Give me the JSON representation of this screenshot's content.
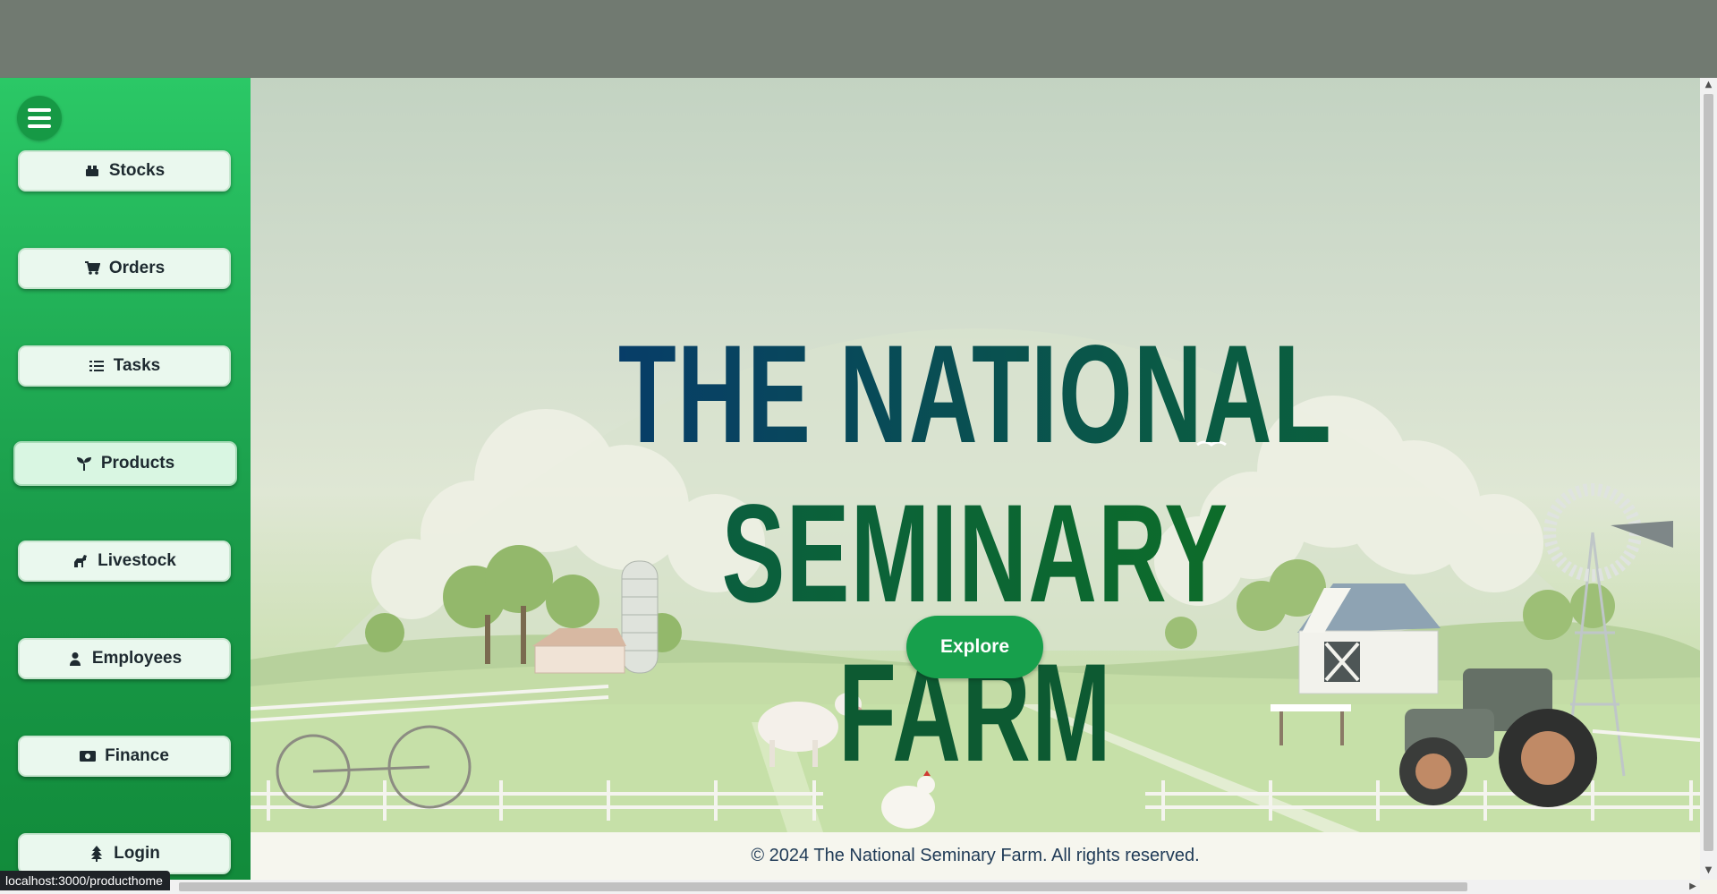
{
  "sidebar": {
    "items": [
      {
        "label": "Stocks",
        "icon": "boxes-icon"
      },
      {
        "label": "Orders",
        "icon": "cart-icon"
      },
      {
        "label": "Tasks",
        "icon": "list-icon"
      },
      {
        "label": "Products",
        "icon": "seedling-icon"
      },
      {
        "label": "Livestock",
        "icon": "horse-icon"
      },
      {
        "label": "Employees",
        "icon": "user-icon"
      },
      {
        "label": "Finance",
        "icon": "money-icon"
      },
      {
        "label": "Login",
        "icon": "tree-icon"
      }
    ]
  },
  "hero": {
    "title_line1": "THE NATIONAL SEMINARY",
    "title_line2": "FARM",
    "explore_label": "Explore"
  },
  "footer": {
    "text": "© 2024 The National Seminary Farm. All rights reserved."
  },
  "status_bar": {
    "url": "localhost:3000/producthome"
  },
  "colors": {
    "sidebar_green": "#1fb559",
    "button_green": "#17a04c",
    "title_blue": "#073d68",
    "title_green": "#0d6c2a"
  }
}
